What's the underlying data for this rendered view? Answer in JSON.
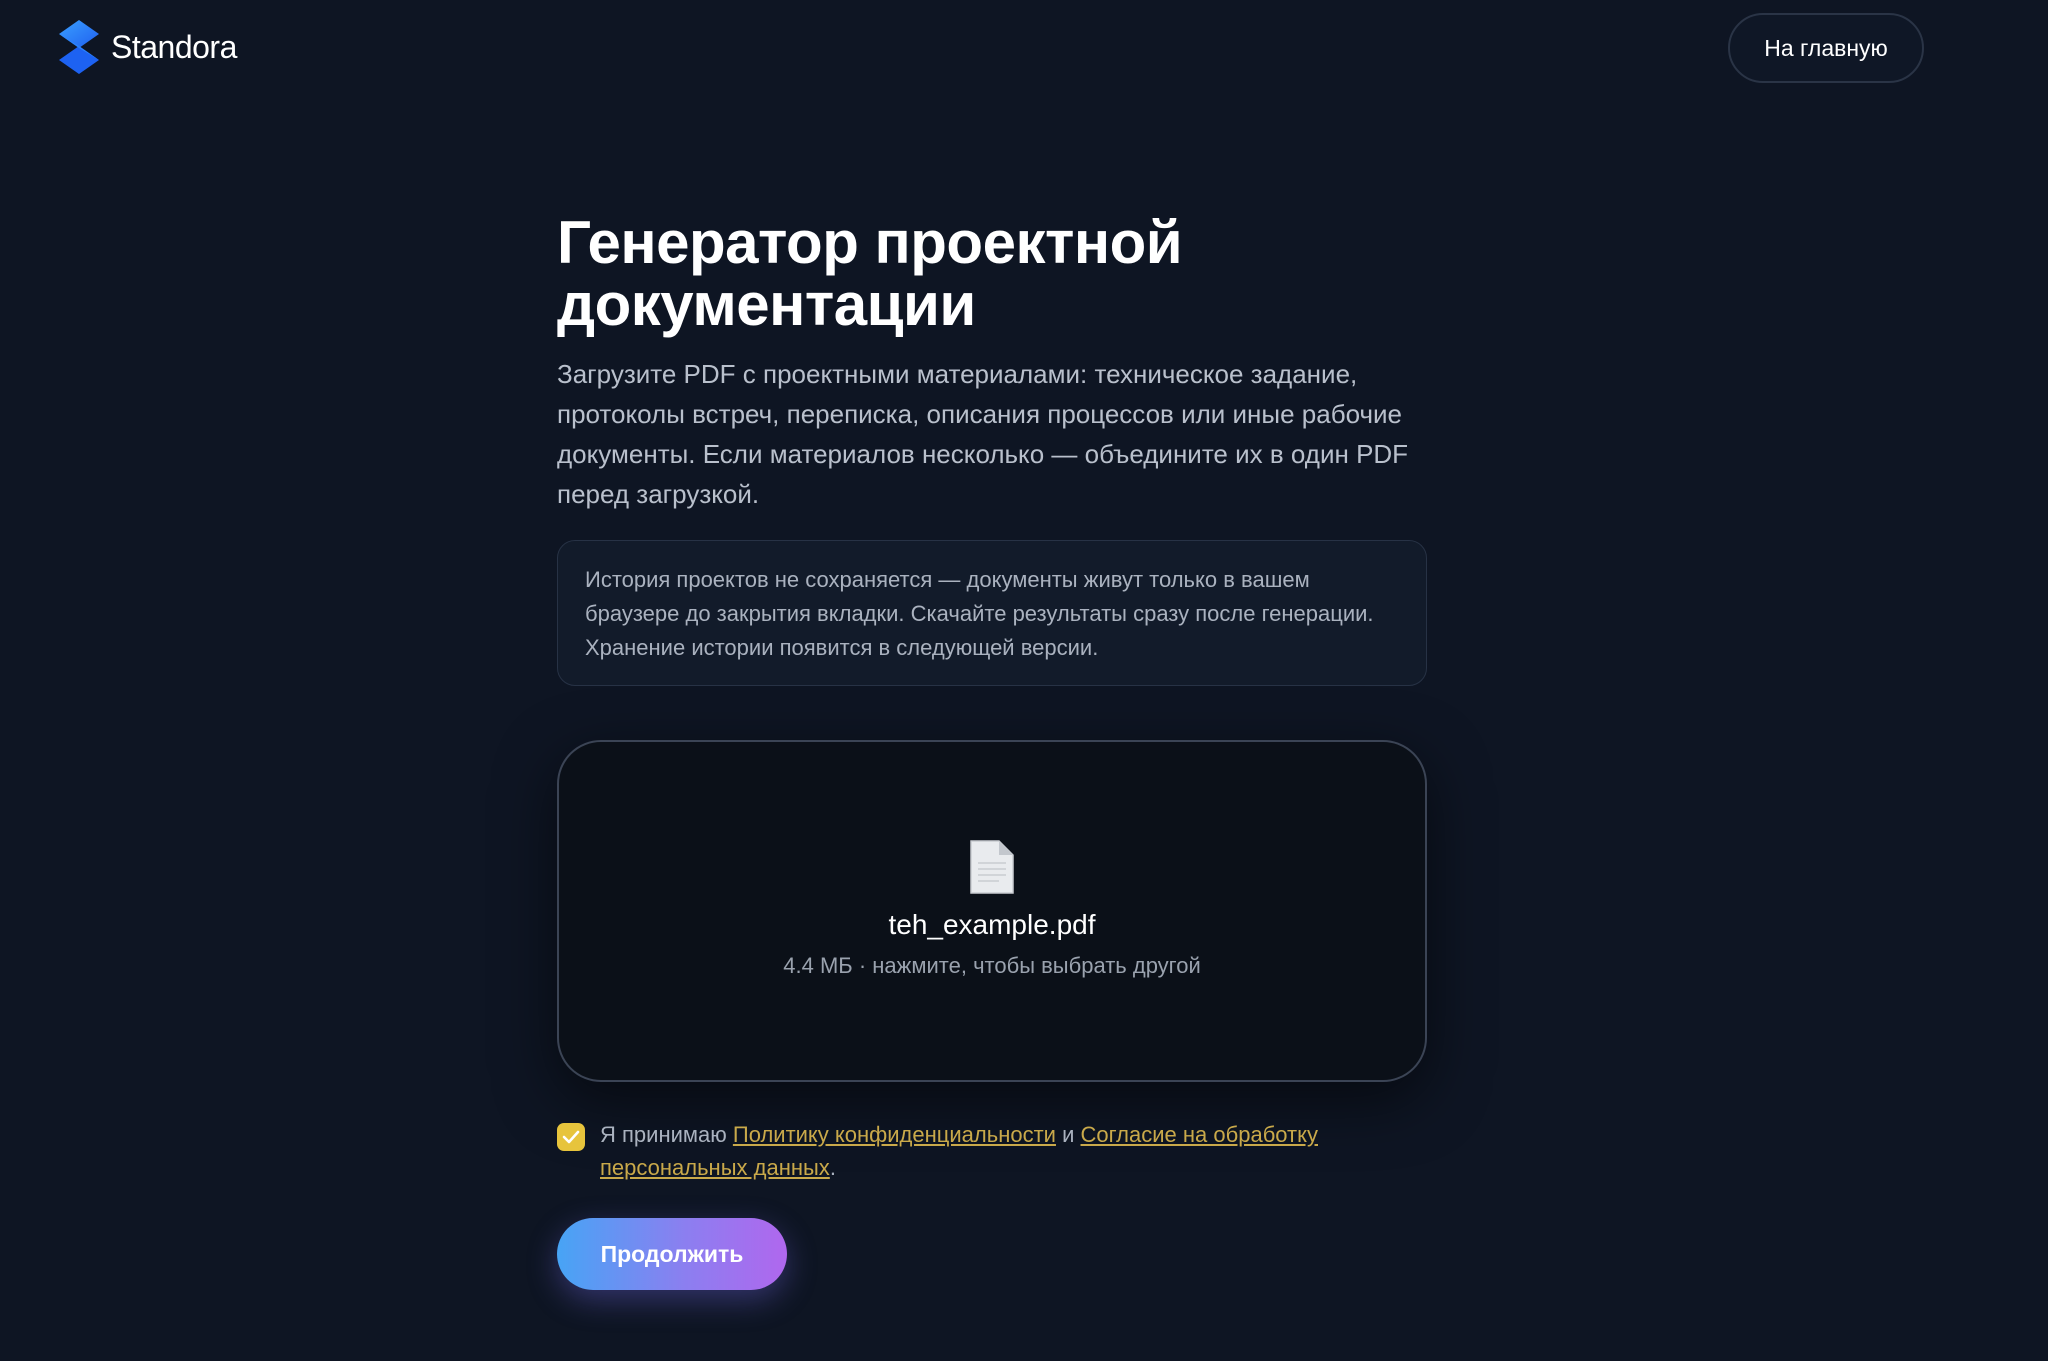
{
  "header": {
    "brand": "Standora",
    "logo_icon": "standora-logo-icon",
    "home_button": "На главную"
  },
  "main": {
    "title_line1": "Генератор проектной",
    "title_line2": "документации",
    "lead": "Загрузите PDF с проектными материалами: техническое задание, протоколы встреч, переписка, описания процессов или иные рабочие документы. Если материалов несколько — объедините их в один PDF перед загрузкой.",
    "note": "История проектов не сохраняется — документы живут только в вашем браузере до закрытия вкладки. Скачайте результаты сразу после генерации. Хранение истории появится в следующей версии."
  },
  "upload": {
    "icon": "document-file-icon",
    "file_name": "teh_example.pdf",
    "file_meta": "4.4 МБ · нажмите, чтобы выбрать другой"
  },
  "consent": {
    "checked": true,
    "prefix": "Я принимаю",
    "privacy_link": "Политику конфиденциальности",
    "conjunction": "и",
    "consent_link": "Согласие на обработку персональных данных",
    "suffix": "."
  },
  "actions": {
    "continue": "Продолжить"
  },
  "colors": {
    "background": "#0e1523",
    "accent_yellow": "#e7c43c",
    "link": "#c9a94a",
    "gradient_start": "#47a4f5",
    "gradient_end": "#b067ee"
  }
}
